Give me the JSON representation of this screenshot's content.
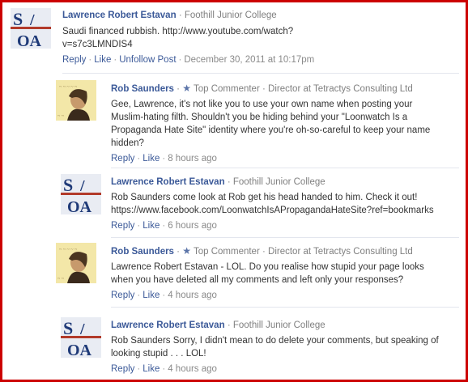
{
  "comments": [
    {
      "name": "Lawrence Robert Estavan",
      "affiliation": "Foothill Junior College",
      "text": "Saudi financed rubbish. http://www.youtube.com/watch?v=s7c3LMNDIS4",
      "reply": "Reply",
      "like": "Like",
      "unfollow": "Unfollow Post",
      "timestamp": "December 30, 2011 at 10:17pm"
    },
    {
      "name": "Rob Saunders",
      "badge": "Top Commenter",
      "affiliation": "Director at Tetractys Consulting Ltd",
      "text": "Gee, Lawrence, it's not like you to use your own name when posting your Muslim-hating filth. Shouldn't you be hiding behind your \"Loonwatch Is a Propaganda Hate Site\" identity where you're oh-so-careful to keep your name hidden?",
      "reply": "Reply",
      "like": "Like",
      "timestamp": "8 hours ago"
    },
    {
      "name": "Lawrence Robert Estavan",
      "affiliation": "Foothill Junior College",
      "text": "Rob Saunders come look at Rob get his head handed to him. Check it out! https://www.facebook.com/LoonwatchIsAPropagandaHateSite?ref=bookmarks",
      "reply": "Reply",
      "like": "Like",
      "timestamp": "6 hours ago"
    },
    {
      "name": "Rob Saunders",
      "badge": "Top Commenter",
      "affiliation": "Director at Tetractys Consulting Ltd",
      "text": "Lawrence Robert Estavan - LOL. Do you realise how stupid your page looks when you have deleted all my comments and left only your responses?",
      "reply": "Reply",
      "like": "Like",
      "timestamp": "4 hours ago"
    },
    {
      "name": "Lawrence Robert Estavan",
      "affiliation": "Foothill Junior College",
      "text": "Rob Saunders Sorry, I didn't mean to do delete your comments, but speaking of looking stupid . . . LOL!",
      "reply": "Reply",
      "like": "Like",
      "timestamp": "4 hours ago"
    }
  ],
  "avatar_labels": {
    "soa": "SOA"
  },
  "icons": {
    "star": "star-icon"
  },
  "colors": {
    "link": "#3b5998",
    "meta": "#7f7f7f",
    "frame": "#cc0000"
  }
}
